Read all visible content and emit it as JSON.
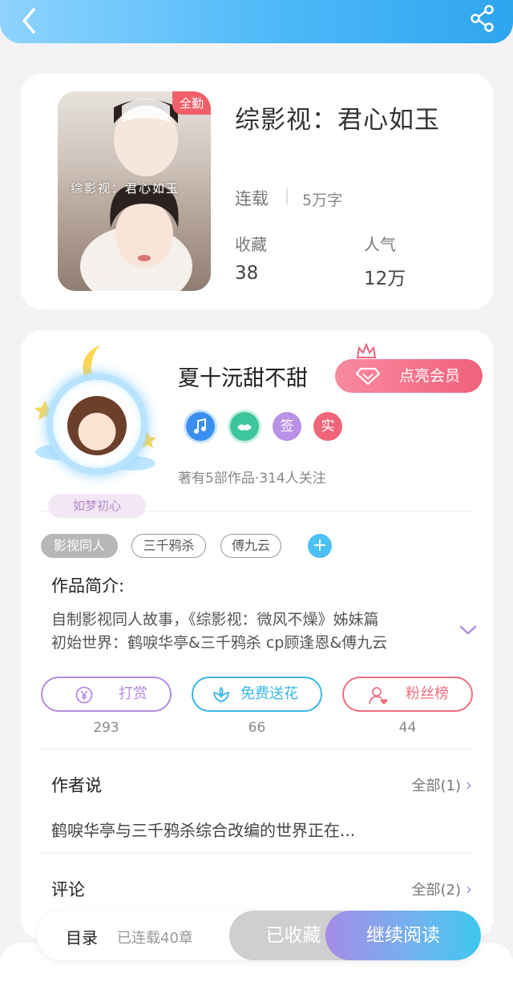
{
  "book": {
    "badge": "全勤",
    "cover_text": "综影视：君心如玉",
    "title": "综影视：君心如玉",
    "status": "连载",
    "word_count": "5万字",
    "favorites_label": "收藏",
    "favorites_value": "38",
    "popularity_label": "人气",
    "popularity_value": "12万"
  },
  "author": {
    "name": "夏十沅甜不甜",
    "fan_name": "如梦初心",
    "vip_button": "点亮会员",
    "medals": [
      {
        "label": "",
        "icon": "music-note-icon",
        "color": "#3a8ef0"
      },
      {
        "label": "",
        "icon": "handshake-icon",
        "color": "#3dc59b"
      },
      {
        "label": "签",
        "icon": "",
        "color": "#b891e6"
      },
      {
        "label": "实",
        "icon": "",
        "color": "#f0657a"
      }
    ],
    "stats": "著有5部作品·314人关注"
  },
  "tags": [
    "影视同人",
    "三千鸦杀",
    "傅九云"
  ],
  "intro": {
    "label": "作品简介:",
    "line1": "自制影视同人故事，《综影视：微风不燥》姊妹篇",
    "line2": "初始世界：鹤唳华亭&三千鸦杀 cp顾逢恩&傅九云"
  },
  "actions": [
    {
      "label": "打赏",
      "count": "293",
      "color": "#b58be0"
    },
    {
      "label": "免费送花",
      "count": "66",
      "color": "#38b8e6"
    },
    {
      "label": "粉丝榜",
      "count": "44",
      "color": "#ef6f7e"
    }
  ],
  "author_says": {
    "label": "作者说",
    "see_all": "全部(1)",
    "preview": "鹤唳华亭与三千鸦杀综合改编的世界正在..."
  },
  "comments": {
    "label": "评论",
    "see_all": "全部(2)"
  },
  "bottom": {
    "toc": "目录",
    "chapters": "已连载40章",
    "collected": "已收藏",
    "continue": "继续阅读"
  }
}
